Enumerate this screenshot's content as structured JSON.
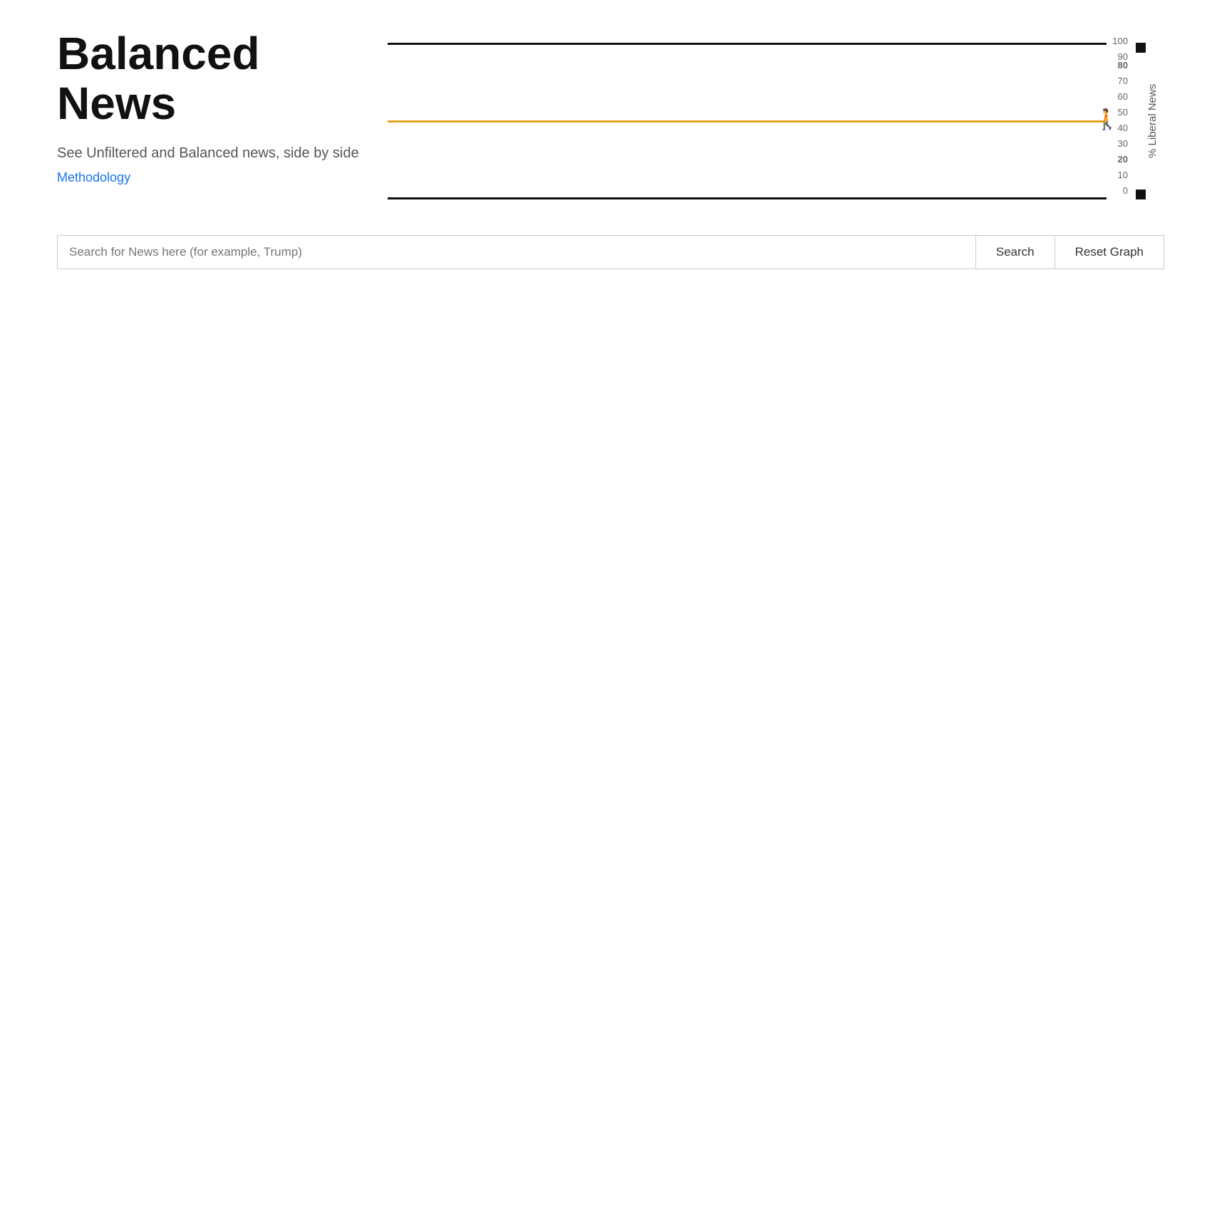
{
  "app": {
    "title_line1": "Balanced",
    "title_line2": "News",
    "subtitle": "See Unfiltered and Balanced news, side by side",
    "methodology_label": "Methodology",
    "methodology_url": "#"
  },
  "chart": {
    "y_axis_title": "% Liberal News",
    "y_axis_labels": [
      {
        "value": "100",
        "pct": 0
      },
      {
        "value": "90",
        "pct": 9.09
      },
      {
        "value": "80",
        "pct": 18.18
      },
      {
        "value": "70",
        "pct": 27.27
      },
      {
        "value": "60",
        "pct": 36.36
      },
      {
        "value": "50",
        "pct": 45.45
      },
      {
        "value": "40",
        "pct": 54.55
      },
      {
        "value": "30",
        "pct": 63.64
      },
      {
        "value": "20",
        "pct": 72.73
      },
      {
        "value": "10",
        "pct": 81.82
      },
      {
        "value": "0",
        "pct": 100
      }
    ],
    "lines": [
      {
        "type": "black",
        "y_position": "top"
      },
      {
        "type": "orange",
        "y_position": "middle"
      },
      {
        "type": "black",
        "y_position": "bottom"
      }
    ],
    "top_dot_label": "80",
    "bottom_dot_label": "20",
    "person_icon": "🚶"
  },
  "search": {
    "placeholder": "Search for News here (for example, Trump)",
    "button_label": "Search",
    "reset_label": "Reset Graph"
  }
}
